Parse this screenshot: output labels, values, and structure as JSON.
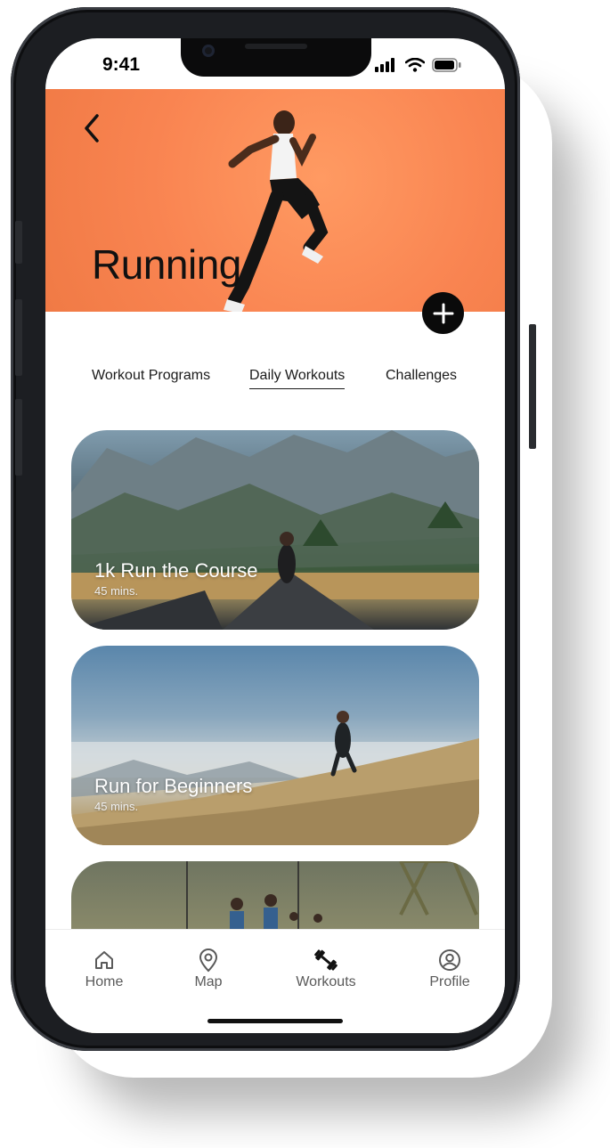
{
  "status_bar": {
    "time": "9:41"
  },
  "hero": {
    "title": "Running",
    "background_color": "#f98451"
  },
  "tabs": [
    {
      "label": "Workout Programs",
      "active": false
    },
    {
      "label": "Daily Workouts",
      "active": true
    },
    {
      "label": "Challenges",
      "active": false
    }
  ],
  "workouts": [
    {
      "title": "1k Run the Course",
      "duration": "45 mins."
    },
    {
      "title": "Run for Beginners",
      "duration": "45 mins."
    }
  ],
  "tab_bar": {
    "items": [
      {
        "label": "Home",
        "icon": "home-icon"
      },
      {
        "label": "Map",
        "icon": "map-pin-icon"
      },
      {
        "label": "Workouts",
        "icon": "dumbbell-icon",
        "active": true
      },
      {
        "label": "Profile",
        "icon": "profile-icon"
      }
    ]
  }
}
